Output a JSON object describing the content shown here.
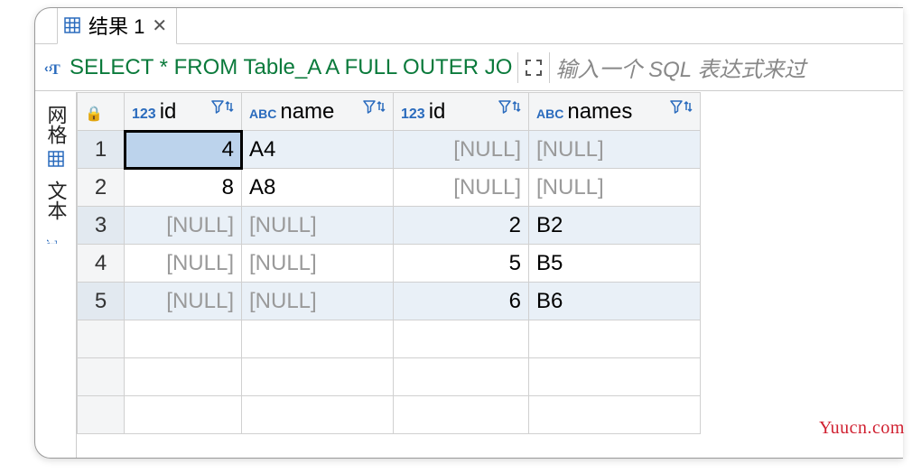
{
  "tab": {
    "title": "结果 1"
  },
  "sql": {
    "text": "SELECT * FROM Table_A A FULL OUTER JO",
    "placeholder": "输入一个 SQL 表达式来过"
  },
  "side": {
    "grid": "网格",
    "text": "文本"
  },
  "columns": [
    {
      "type": "num",
      "label": "id"
    },
    {
      "type": "abc",
      "label": "name"
    },
    {
      "type": "num",
      "label": "id"
    },
    {
      "type": "abc",
      "label": "names"
    }
  ],
  "rows": [
    {
      "n": "1",
      "cells": [
        "4",
        "A4",
        "[NULL]",
        "[NULL]"
      ],
      "nulls": [
        false,
        false,
        true,
        true
      ],
      "selected": 0
    },
    {
      "n": "2",
      "cells": [
        "8",
        "A8",
        "[NULL]",
        "[NULL]"
      ],
      "nulls": [
        false,
        false,
        true,
        true
      ]
    },
    {
      "n": "3",
      "cells": [
        "[NULL]",
        "[NULL]",
        "2",
        "B2"
      ],
      "nulls": [
        true,
        true,
        false,
        false
      ]
    },
    {
      "n": "4",
      "cells": [
        "[NULL]",
        "[NULL]",
        "5",
        "B5"
      ],
      "nulls": [
        true,
        true,
        false,
        false
      ]
    },
    {
      "n": "5",
      "cells": [
        "[NULL]",
        "[NULL]",
        "6",
        "B6"
      ],
      "nulls": [
        true,
        true,
        false,
        false
      ]
    }
  ],
  "watermark": "Yuucn.com"
}
